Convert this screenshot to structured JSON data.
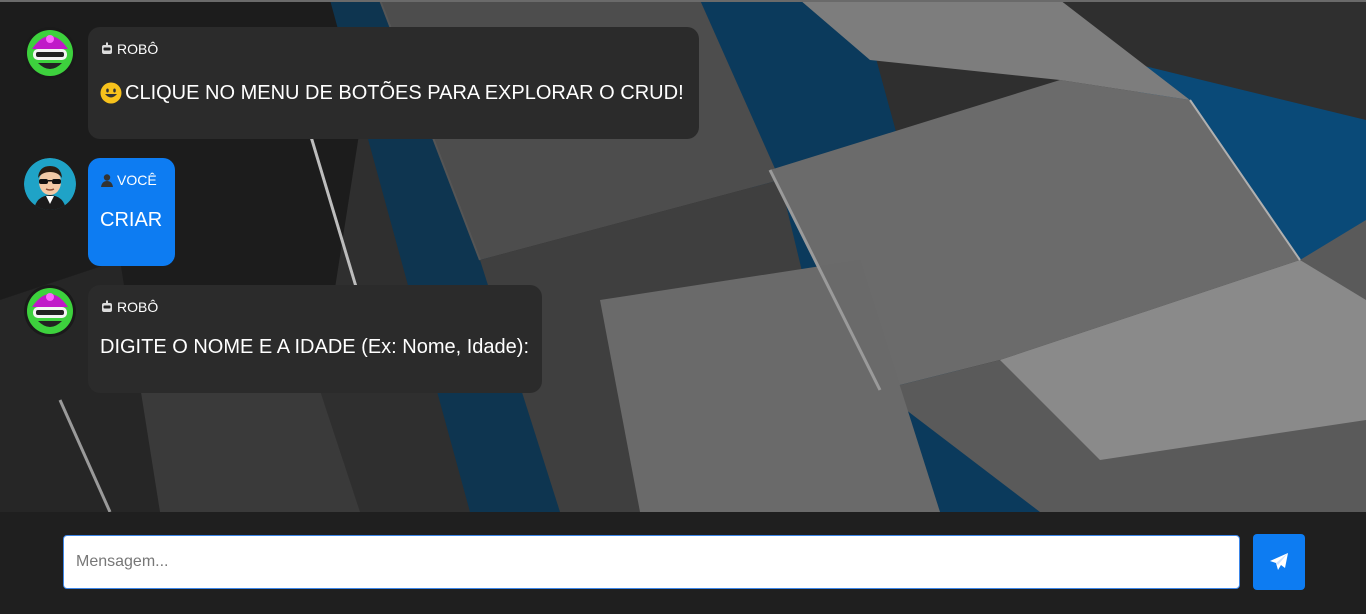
{
  "messages": [
    {
      "role": "bot",
      "sender": "ROBÔ",
      "sender_icon": "robot-icon",
      "text": "CLIQUE NO MENU DE BOTÕES PARA EXPLORAR O CRUD!",
      "leading_icon": "smiley-icon"
    },
    {
      "role": "user",
      "sender": "VOCÊ",
      "sender_icon": "person-icon",
      "text": "CRIAR"
    },
    {
      "role": "bot",
      "sender": "ROBÔ",
      "sender_icon": "robot-icon",
      "text": "DIGITE O NOME E A IDADE (Ex: Nome, Idade):"
    }
  ],
  "composer": {
    "placeholder": "Mensagem...",
    "value": "",
    "send_icon": "paper-plane-icon"
  },
  "colors": {
    "bot_bubble": "#2b2b2b",
    "user_bubble": "#0d7cf2",
    "accent": "#0d7cf2",
    "footer": "#1f1f1f"
  }
}
